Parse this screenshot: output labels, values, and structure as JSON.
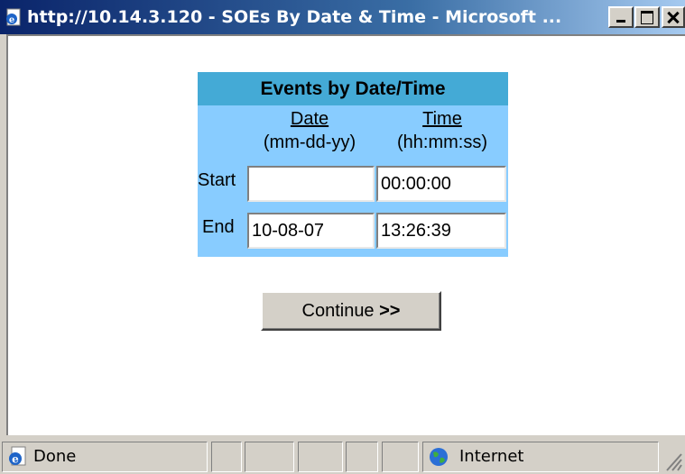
{
  "window": {
    "title": "http://10.14.3.120 - SOEs By Date & Time - Microsoft ..."
  },
  "form": {
    "header": "Events by Date/Time",
    "date_label": "Date",
    "date_format": "(mm-dd-yy)",
    "time_label": "Time",
    "time_format": "(hh:mm:ss)",
    "start_label": "Start",
    "end_label": "End",
    "start_date": "",
    "start_time": "00:00:00",
    "end_date": "10-08-07",
    "end_time": "13:26:39",
    "continue_label": "Continue",
    "continue_arrows": ">>"
  },
  "status": {
    "text": "Done",
    "zone": "Internet"
  },
  "icons": {
    "title": "ie-page-icon",
    "minimize": "minimize-icon",
    "maximize": "maximize-icon",
    "close": "close-icon",
    "status": "ie-icon",
    "zone": "globe-icon",
    "grip": "resize-grip-icon"
  },
  "colors": {
    "table_header": "#44aad6",
    "table_body": "#88ccff",
    "titlebar_start": "#0a246a"
  }
}
